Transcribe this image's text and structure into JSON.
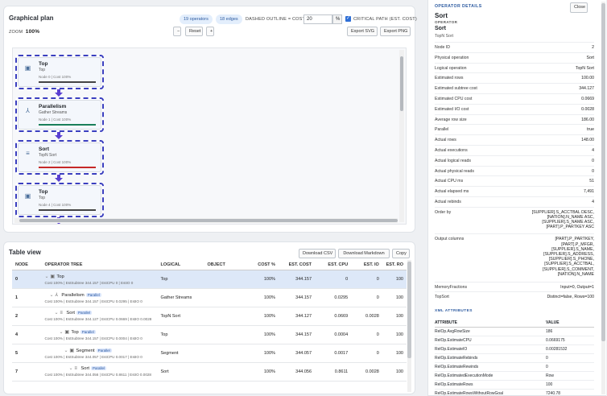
{
  "plan": {
    "title": "Graphical plan",
    "operators_pill": "19 operators",
    "edges_pill": "18 edges",
    "dashed_label": "DASHED OUTLINE = COST",
    "cost_threshold": "20",
    "percent": "%",
    "critical_label": "CRITICAL PATH (EST. COST)",
    "zoom_label": "ZOOM",
    "zoom_value": "100%",
    "btn_minus": "−",
    "btn_reset": "Reset",
    "btn_plus": "+",
    "btn_export_svg": "Export SVG",
    "btn_export_png": "Export PNG",
    "nodes": [
      {
        "name": "Top",
        "sub": "Top",
        "meta": "Node 0 | Cost 100%",
        "icon": "▣",
        "bar": "#444444"
      },
      {
        "name": "Parallelism",
        "sub": "Gather Streams",
        "meta": "Node 1 | Cost 100%",
        "icon": "⅄",
        "bar": "#1a7f5a"
      },
      {
        "name": "Sort",
        "sub": "TopN Sort",
        "meta": "Node 2 | Cost 100%",
        "icon": "≡",
        "bar": "#c62828"
      },
      {
        "name": "Top",
        "sub": "Top",
        "meta": "Node 4 | Cost 100%",
        "icon": "▣",
        "bar": "#444444"
      }
    ]
  },
  "table": {
    "title": "Table view",
    "btn_csv": "Download CSV",
    "btn_md": "Download Markdown",
    "btn_copy": "Copy",
    "columns": [
      "NODE",
      "OPERATOR TREE",
      "LOGICAL",
      "OBJECT",
      "COST %",
      "EST. COST",
      "EST. CPU",
      "EST. IO",
      "EST. RO"
    ],
    "parallel_badge": "Parallel",
    "rows": [
      {
        "node": "0",
        "indent": 0,
        "icon": "▣",
        "op": "Top",
        "parallel": false,
        "detail": "Cost 100% | EstSubtree 344.157 | EstCPU 0 | EstIO 0",
        "logical": "Top",
        "object": "",
        "cost": "100%",
        "est_cost": "344.157",
        "cpu": "0",
        "io": "0",
        "ro": "100"
      },
      {
        "node": "1",
        "indent": 1,
        "icon": "⅄",
        "op": "Parallelism",
        "parallel": true,
        "detail": "Cost 100% | EstSubtree 344.157 | EstCPU 0.0295 | EstIO 0",
        "logical": "Gather Streams",
        "object": "",
        "cost": "100%",
        "est_cost": "344.157",
        "cpu": "0.0295",
        "io": "0",
        "ro": "100"
      },
      {
        "node": "2",
        "indent": 2,
        "icon": "≡",
        "op": "Sort",
        "parallel": true,
        "detail": "Cost 100% | EstSubtree 344.127 | EstCPU 0.0669 | EstIO 0.0028",
        "logical": "TopN Sort",
        "object": "",
        "cost": "100%",
        "est_cost": "344.127",
        "cpu": "0.0669",
        "io": "0.0028",
        "ro": "100"
      },
      {
        "node": "4",
        "indent": 3,
        "icon": "▣",
        "op": "Top",
        "parallel": true,
        "detail": "Cost 100% | EstSubtree 344.157 | EstCPU 0.0004 | EstIO 0",
        "logical": "Top",
        "object": "",
        "cost": "100%",
        "est_cost": "344.157",
        "cpu": "0.0004",
        "io": "0",
        "ro": "100"
      },
      {
        "node": "5",
        "indent": 4,
        "icon": "▣",
        "op": "Segment",
        "parallel": true,
        "detail": "Cost 100% | EstSubtree 344.057 | EstCPU 0.0017 | EstIO 0",
        "logical": "Segment",
        "object": "",
        "cost": "100%",
        "est_cost": "344.057",
        "cpu": "0.0017",
        "io": "0",
        "ro": "100"
      },
      {
        "node": "7",
        "indent": 5,
        "icon": "≡",
        "op": "Sort",
        "parallel": true,
        "detail": "Cost 100% | EstSubtree 344.056 | EstCPU 0.8611 | EstIO 0.0028",
        "logical": "Sort",
        "object": "",
        "cost": "100%",
        "est_cost": "344.056",
        "cpu": "0.8611",
        "io": "0.0028",
        "ro": "100"
      }
    ]
  },
  "details": {
    "header": "OPERATOR DETAILS",
    "close": "Close",
    "title": "Sort",
    "kind_label": "OPERATOR",
    "op_name": "Sort",
    "op_sub": "TopN Sort",
    "props": [
      {
        "k": "Node ID",
        "v": "2"
      },
      {
        "k": "Physical operation",
        "v": "Sort"
      },
      {
        "k": "Logical operation",
        "v": "TopN Sort"
      },
      {
        "k": "Estimated rows",
        "v": "100.00"
      },
      {
        "k": "Estimated subtree cost",
        "v": "344.127"
      },
      {
        "k": "Estimated CPU cost",
        "v": "0.0669"
      },
      {
        "k": "Estimated I/O cost",
        "v": "0.0028"
      },
      {
        "k": "Average row size",
        "v": "186.00"
      },
      {
        "k": "Parallel",
        "v": "true"
      },
      {
        "k": "Actual rows",
        "v": "148.00"
      },
      {
        "k": "Actual executions",
        "v": "4"
      },
      {
        "k": "Actual logical reads",
        "v": "0"
      },
      {
        "k": "Actual physical reads",
        "v": "0"
      },
      {
        "k": "Actual CPU ms",
        "v": "51"
      },
      {
        "k": "Actual elapsed ms",
        "v": "7,491"
      },
      {
        "k": "Actual rebinds",
        "v": "4"
      },
      {
        "k": "Order by",
        "v": "[SUPPLIER].S_ACCTBAL DESC,\n[NATION].N_NAME ASC,\n[SUPPLIER].S_NAME ASC,\n[PART].P_PARTKEY ASC"
      },
      {
        "k": "Output columns",
        "v": "[PART].P_PARTKEY,\n[PART].P_MFGR,\n[SUPPLIER].S_NAME,\n[SUPPLIER].S_ADDRESS,\n[SUPPLIER].S_PHONE,\n[SUPPLIER].S_ACCTBAL,\n[SUPPLIER].S_COMMENT,\n[NATION].N_NAME"
      },
      {
        "k": "MemoryFractions",
        "v": "Input=0, Output=1"
      },
      {
        "k": "TopSort",
        "v": "Distinct=false, Rows=100"
      }
    ],
    "xml_header": "XML ATTRIBUTES",
    "xml_columns": [
      "ATTRIBUTE",
      "VALUE"
    ],
    "xml_rows": [
      {
        "k": "RelOp.AvgRowSize",
        "v": "186"
      },
      {
        "k": "RelOp.EstimateCPU",
        "v": "0.0669175"
      },
      {
        "k": "RelOp.EstimateIO",
        "v": "0.00281532"
      },
      {
        "k": "RelOp.EstimateRebinds",
        "v": "0"
      },
      {
        "k": "RelOp.EstimateRewinds",
        "v": "0"
      },
      {
        "k": "RelOp.EstimatedExecutionMode",
        "v": "Row"
      },
      {
        "k": "RelOp.EstimateRows",
        "v": "100"
      },
      {
        "k": "RelOp.EstimateRowsWithoutRowGoal",
        "v": "7240.78"
      }
    ]
  }
}
